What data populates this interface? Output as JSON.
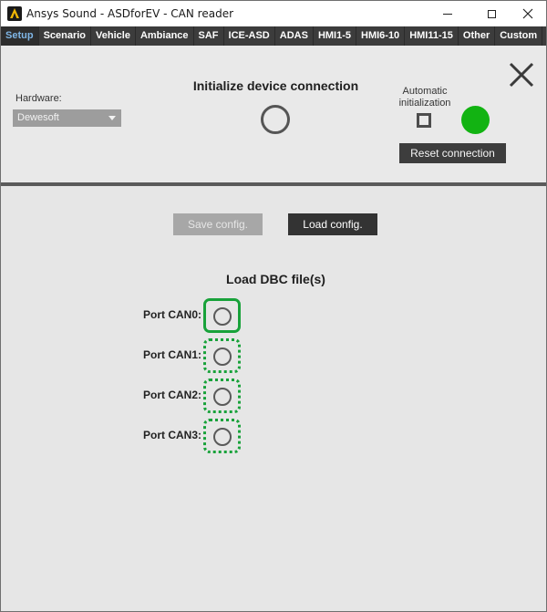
{
  "window": {
    "title": "Ansys Sound - ASDforEV - CAN reader",
    "icon": "ansys-logo-icon"
  },
  "tabs": [
    {
      "label": "Setup",
      "active": true
    },
    {
      "label": "Scenario",
      "active": false
    },
    {
      "label": "Vehicle",
      "active": false
    },
    {
      "label": "Ambiance",
      "active": false
    },
    {
      "label": "SAF",
      "active": false
    },
    {
      "label": "ICE-ASD",
      "active": false
    },
    {
      "label": "ADAS",
      "active": false
    },
    {
      "label": "HMI1-5",
      "active": false
    },
    {
      "label": "HMI6-10",
      "active": false
    },
    {
      "label": "HMI11-15",
      "active": false
    },
    {
      "label": "Other",
      "active": false
    },
    {
      "label": "Custom",
      "active": false
    },
    {
      "label": "?",
      "active": false
    }
  ],
  "device": {
    "hardware_label": "Hardware:",
    "hardware_value": "Dewesoft",
    "init_title": "Initialize device connection",
    "auto_init_label_line1": "Automatic",
    "auto_init_label_line2": "initialization",
    "auto_init_checked": false,
    "connection_status_color": "#12b312",
    "reset_label": "Reset connection",
    "close_icon": "close-icon"
  },
  "config": {
    "save_label": "Save config.",
    "save_enabled": false,
    "load_label": "Load config."
  },
  "dbc": {
    "title": "Load DBC file(s)",
    "ports": [
      {
        "label": "Port CAN0:",
        "state": "active"
      },
      {
        "label": "Port CAN1:",
        "state": "pending"
      },
      {
        "label": "Port CAN2:",
        "state": "pending"
      },
      {
        "label": "Port CAN3:",
        "state": "pending"
      }
    ]
  },
  "colors": {
    "tab_active_text": "#7fb6e6",
    "port_border": "#18a23a",
    "status_led": "#12b312"
  }
}
